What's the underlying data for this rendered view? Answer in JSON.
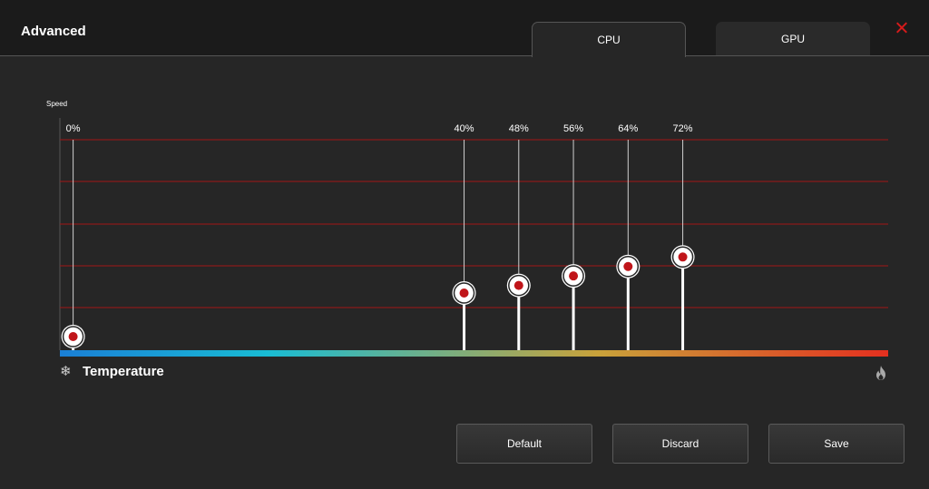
{
  "window": {
    "title": "Advanced"
  },
  "tabs": [
    {
      "label": "CPU",
      "active": true
    },
    {
      "label": "GPU",
      "active": false
    }
  ],
  "chart_data": {
    "type": "line",
    "ylabel": "Speed",
    "xlabel": "Temperature",
    "ylim": [
      0,
      100
    ],
    "xlim": [
      0,
      100
    ],
    "points": [
      {
        "x": 1.6,
        "y": 0,
        "label": "0%"
      },
      {
        "x": 48.8,
        "y": 23,
        "label": "40%"
      },
      {
        "x": 55.4,
        "y": 27,
        "label": "48%"
      },
      {
        "x": 62.0,
        "y": 32,
        "label": "56%"
      },
      {
        "x": 68.6,
        "y": 37,
        "label": "64%"
      },
      {
        "x": 75.2,
        "y": 42,
        "label": "72%"
      }
    ],
    "grid_lines": 5,
    "colors": {
      "grid": "#a31515",
      "point": "#c0151a",
      "gradient": [
        "#1a7fd6",
        "#19bcd4",
        "#c9a23a",
        "#e4301f"
      ]
    }
  },
  "buttons": {
    "default_label": "Default",
    "discard_label": "Discard",
    "save_label": "Save"
  },
  "icons": {
    "snowflake": "❄",
    "flame": "flame-icon"
  }
}
